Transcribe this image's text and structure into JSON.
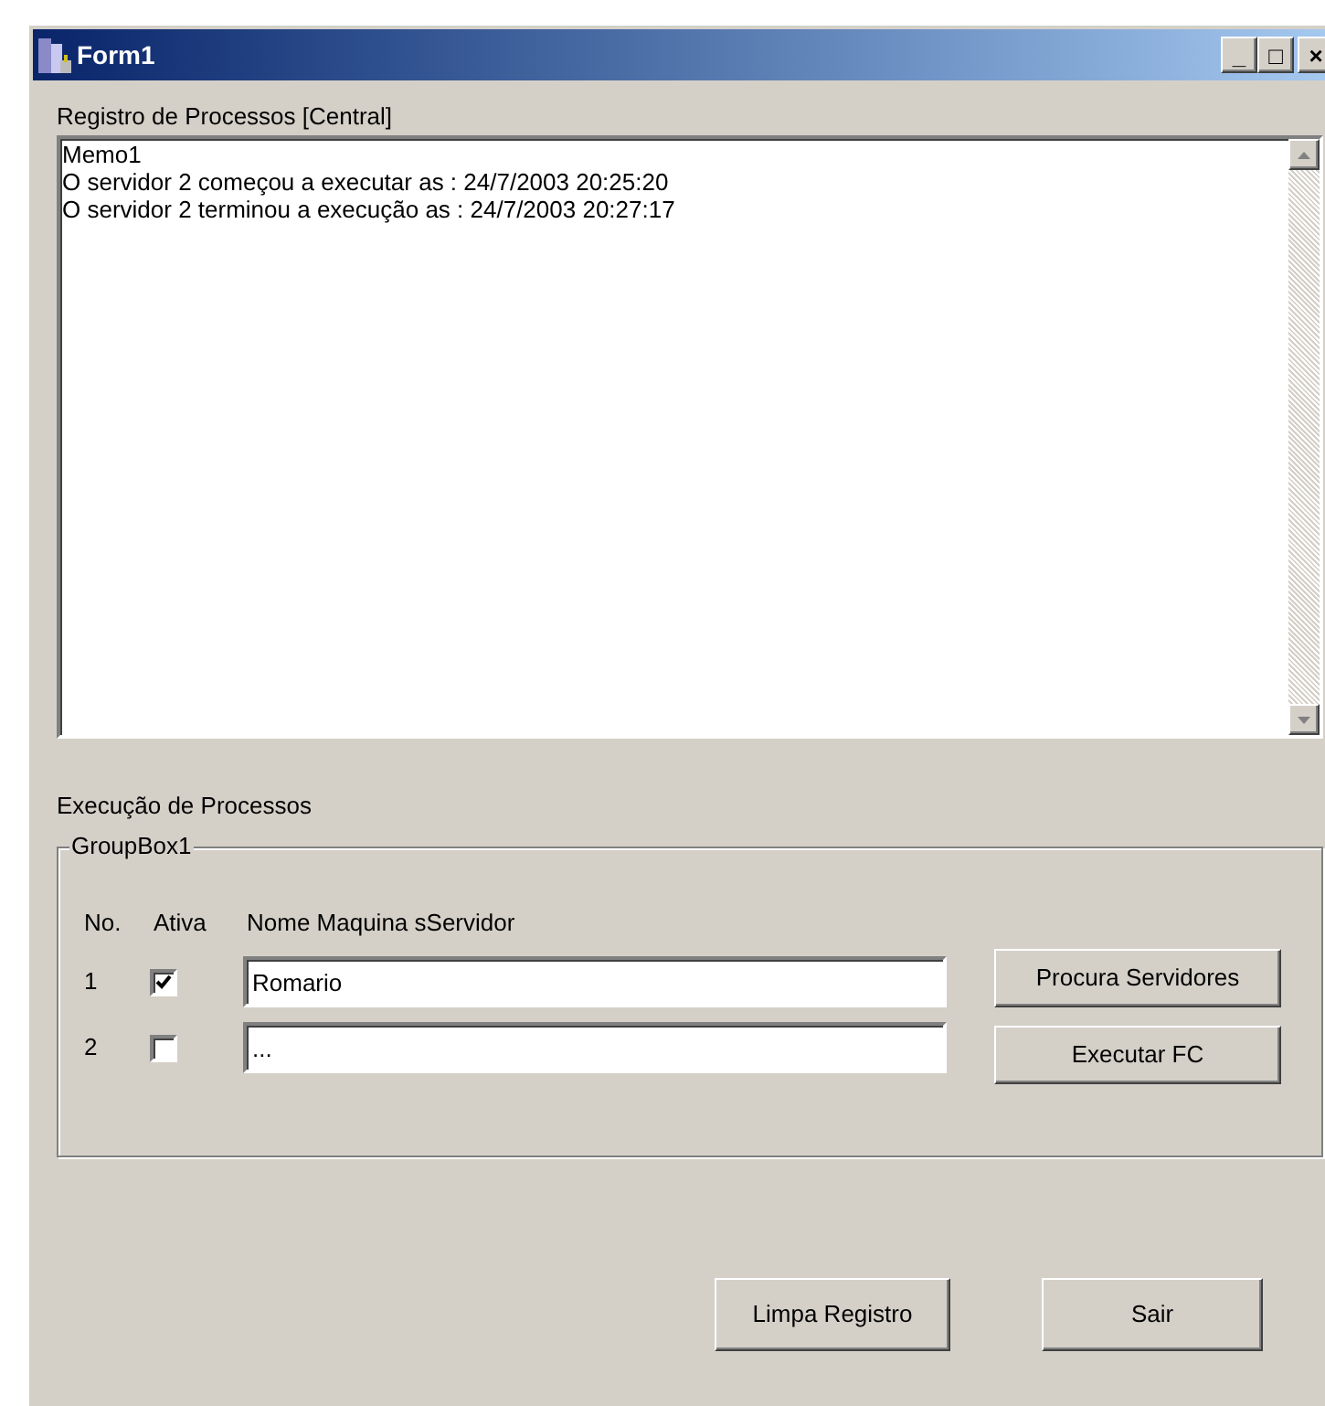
{
  "window": {
    "title": "Form1",
    "controls": [
      "_",
      "□",
      "×"
    ]
  },
  "log_label": "Registro de Processos [Central]",
  "memo": {
    "lines": [
      "Memo1",
      "O servidor 2 começou a executar as : 24/7/2003 20:25:20",
      "O servidor 2 terminou a execução as : 24/7/2003 20:27:17"
    ]
  },
  "execution_label": "Execução de Processos",
  "group": {
    "title": "GroupBox1",
    "columns": [
      "No.",
      "Ativa",
      "Nome Maquina sServidor"
    ],
    "rows": [
      {
        "number": "1",
        "checked": true,
        "value": "Romario"
      },
      {
        "number": "2",
        "checked": false,
        "value": "..."
      }
    ],
    "buttons": [
      "Procura Servidores",
      "Executar FC"
    ]
  },
  "buttons": [
    "Limpa Registro",
    "Sair"
  ]
}
